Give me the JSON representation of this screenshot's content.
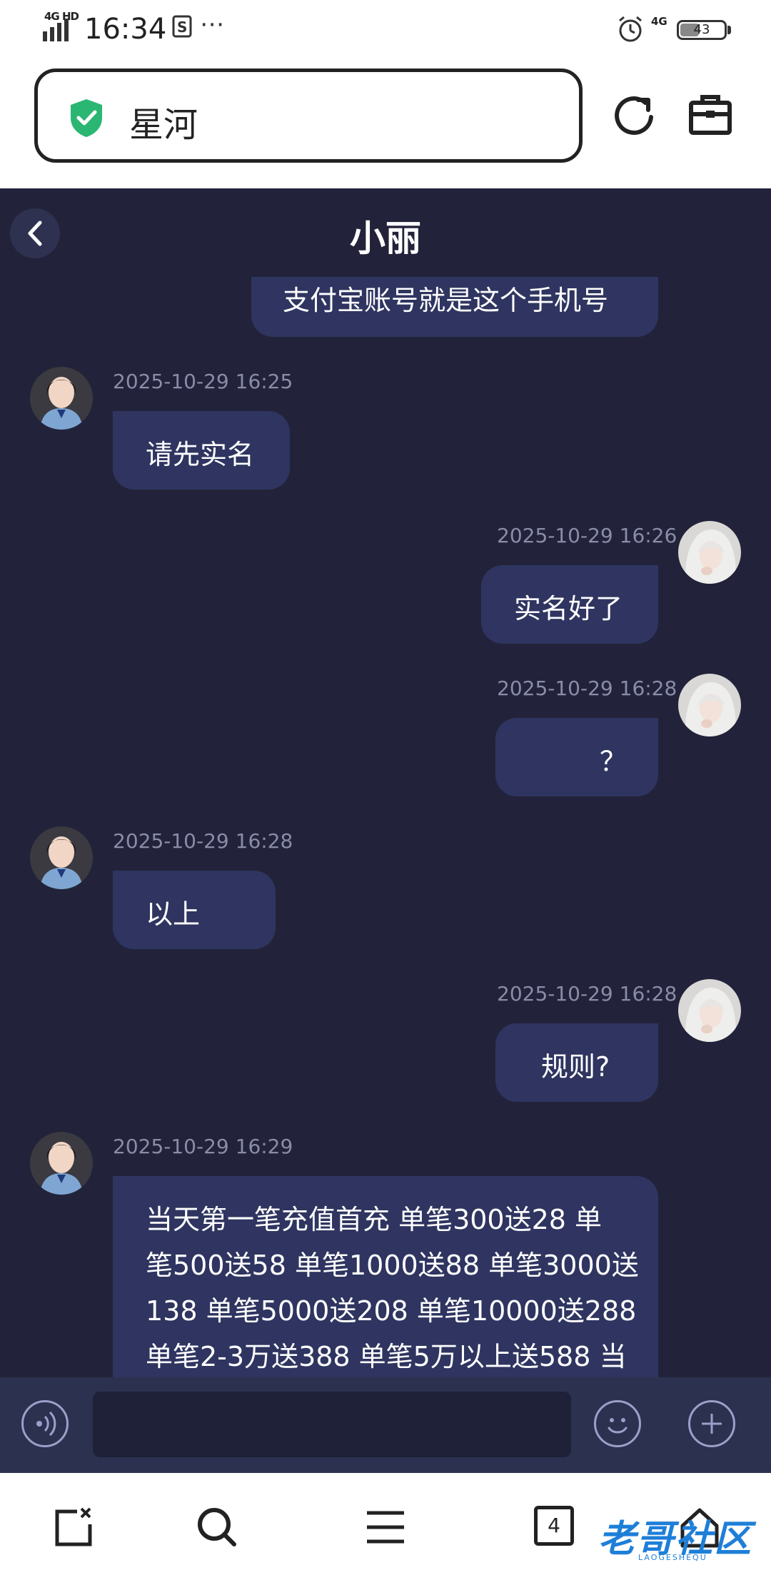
{
  "status_bar": {
    "network": "4G HD",
    "time": "16:34",
    "extra": "⋯",
    "network_right": "4G",
    "battery": "43",
    "battery_level": 0.43
  },
  "address_bar": {
    "site_name": "星河",
    "shield_color": "#2bb673"
  },
  "chat": {
    "title": "小丽",
    "messages": [
      {
        "direction": "out",
        "timestamp": "",
        "text": "支付宝账号就是这个手机号"
      },
      {
        "direction": "in",
        "timestamp": "2025-10-29 16:25",
        "text": "请先实名"
      },
      {
        "direction": "out",
        "timestamp": "2025-10-29 16:26",
        "text": "实名好了"
      },
      {
        "direction": "out",
        "timestamp": "2025-10-29 16:28",
        "text": "？"
      },
      {
        "direction": "in",
        "timestamp": "2025-10-29 16:28",
        "text": "以上"
      },
      {
        "direction": "out",
        "timestamp": "2025-10-29 16:28",
        "text": "规则?"
      },
      {
        "direction": "in",
        "timestamp": "2025-10-29 16:29",
        "lines": [
          "当天第一笔充值首充 单笔300送28 单",
          "笔500送58 单笔1000送88 单笔3000送",
          "138 单笔5000送208 单笔10000送288",
          "单笔2-3万送388 单笔5万以上送588 当"
        ]
      }
    ]
  },
  "input_bar": {
    "placeholder": ""
  },
  "bottom_nav": {
    "tab_count": "4",
    "watermark": "老哥社区",
    "watermark_sub": "LAOGESHEQU"
  },
  "colors": {
    "chat_bg": "#22233a",
    "bubble": "#2f3560",
    "timestamp": "#8a8ca8"
  }
}
